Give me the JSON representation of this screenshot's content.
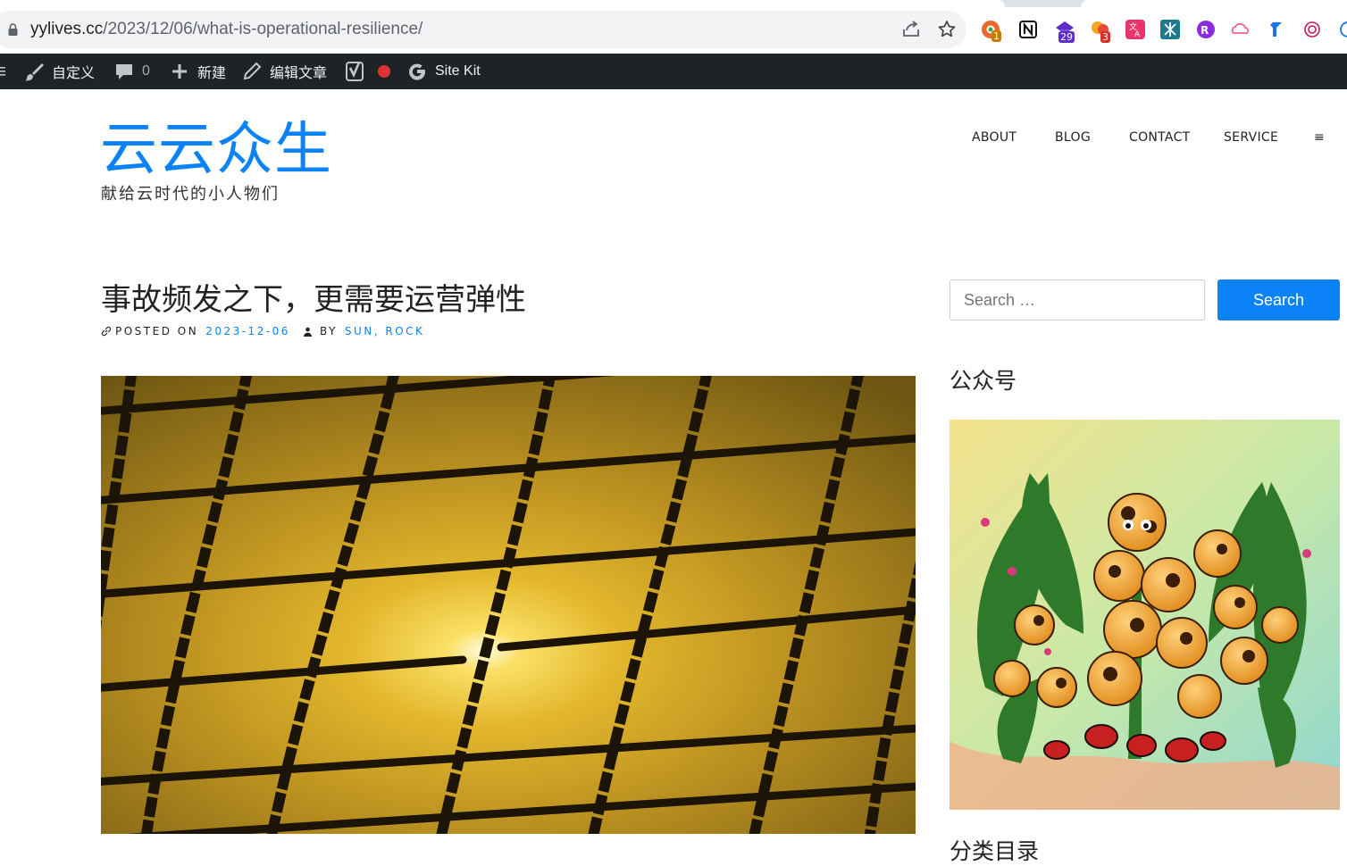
{
  "browser": {
    "url_host": "yylives.cc",
    "url_path": "/2023/12/06/what-is-operational-resilience/",
    "extension_badges": {
      "ext1": "1",
      "ext3": "29",
      "ext4": "3"
    }
  },
  "admin_bar": {
    "customize": "自定义",
    "comments_count": "0",
    "new": "新建",
    "edit_post": "编辑文章",
    "site_kit": "Site Kit"
  },
  "site": {
    "title": "云云众生",
    "tagline": "献给云时代的小人物们",
    "accent_color": "#0b82f5"
  },
  "nav": {
    "items": [
      "ABOUT",
      "BLOG",
      "CONTACT",
      "SERVICE"
    ],
    "menu_icon": "≡"
  },
  "post": {
    "title": "事故频发之下，更需要运营弹性",
    "posted_on_label": "POSTED ON",
    "date": "2023-12-06",
    "by_label": "BY",
    "author": "SUN, ROCK"
  },
  "sidebar": {
    "search_placeholder": "Search …",
    "search_button": "Search",
    "widget1_title": "公众号",
    "widget2_title": "分类目录"
  }
}
